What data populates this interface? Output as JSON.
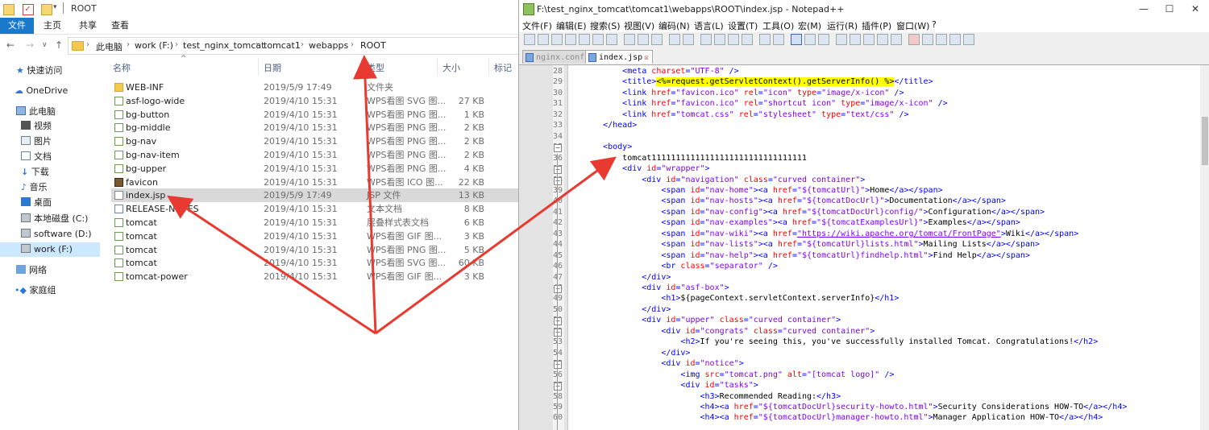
{
  "explorer": {
    "title": "ROOT",
    "ribbon_tabs": [
      "文件",
      "主页",
      "共享",
      "查看"
    ],
    "breadcrumb": [
      "此电脑",
      "work (F:)",
      "test_nginx_tomcat",
      "tomcat1",
      "webapps",
      "ROOT"
    ],
    "sidebar": [
      {
        "label": "快速访问",
        "icon": "star-icon"
      },
      {
        "label": "OneDrive",
        "icon": "cloud-icon"
      },
      {
        "label": "此电脑",
        "icon": "computer-icon"
      },
      {
        "label": "视频",
        "icon": "video-icon"
      },
      {
        "label": "图片",
        "icon": "picture-icon"
      },
      {
        "label": "文档",
        "icon": "document-icon"
      },
      {
        "label": "下载",
        "icon": "download-icon"
      },
      {
        "label": "音乐",
        "icon": "music-icon"
      },
      {
        "label": "桌面",
        "icon": "desktop-icon"
      },
      {
        "label": "本地磁盘 (C:)",
        "icon": "drive-icon"
      },
      {
        "label": "software (D:)",
        "icon": "drive-icon"
      },
      {
        "label": "work (F:)",
        "icon": "drive-icon",
        "selected": true
      },
      {
        "label": "网络",
        "icon": "network-icon"
      },
      {
        "label": "家庭组",
        "icon": "homegroup-icon"
      }
    ],
    "columns": {
      "name": "名称",
      "date": "日期",
      "type": "类型",
      "size": "大小",
      "tags": "标记"
    },
    "files": [
      {
        "name": "WEB-INF",
        "date": "2019/5/9 17:49",
        "type": "文件夹",
        "size": "",
        "icon": "folder-icon"
      },
      {
        "name": "asf-logo-wide",
        "date": "2019/4/10 15:31",
        "type": "WPS看图 SVG 图...",
        "size": "27 KB",
        "icon": "image-icon"
      },
      {
        "name": "bg-button",
        "date": "2019/4/10 15:31",
        "type": "WPS看图 PNG 图...",
        "size": "1 KB",
        "icon": "image-icon"
      },
      {
        "name": "bg-middle",
        "date": "2019/4/10 15:31",
        "type": "WPS看图 PNG 图...",
        "size": "2 KB",
        "icon": "image-icon"
      },
      {
        "name": "bg-nav",
        "date": "2019/4/10 15:31",
        "type": "WPS看图 PNG 图...",
        "size": "2 KB",
        "icon": "image-icon"
      },
      {
        "name": "bg-nav-item",
        "date": "2019/4/10 15:31",
        "type": "WPS看图 PNG 图...",
        "size": "2 KB",
        "icon": "image-icon"
      },
      {
        "name": "bg-upper",
        "date": "2019/4/10 15:31",
        "type": "WPS看图 PNG 图...",
        "size": "4 KB",
        "icon": "image-icon"
      },
      {
        "name": "favicon",
        "date": "2019/4/10 15:31",
        "type": "WPS看图 ICO 图...",
        "size": "22 KB",
        "icon": "favicon-icon"
      },
      {
        "name": "index.jsp",
        "date": "2019/5/9 17:49",
        "type": "JSP 文件",
        "size": "13 KB",
        "icon": "file-icon",
        "selected": true
      },
      {
        "name": "RELEASE-NOTES",
        "date": "2019/4/10 15:31",
        "type": "文本文档",
        "size": "8 KB",
        "icon": "text-file-icon"
      },
      {
        "name": "tomcat",
        "date": "2019/4/10 15:31",
        "type": "层叠样式表文档",
        "size": "6 KB",
        "icon": "css-file-icon"
      },
      {
        "name": "tomcat",
        "date": "2019/4/10 15:31",
        "type": "WPS看图 GIF 图...",
        "size": "3 KB",
        "icon": "image-icon"
      },
      {
        "name": "tomcat",
        "date": "2019/4/10 15:31",
        "type": "WPS看图 PNG 图...",
        "size": "5 KB",
        "icon": "image-icon"
      },
      {
        "name": "tomcat",
        "date": "2019/4/10 15:31",
        "type": "WPS看图 SVG 图...",
        "size": "60 KB",
        "icon": "image-icon"
      },
      {
        "name": "tomcat-power",
        "date": "2019/4/10 15:31",
        "type": "WPS看图 GIF 图...",
        "size": "3 KB",
        "icon": "image-icon"
      }
    ]
  },
  "npp": {
    "title": "F:\\test_nginx_tomcat\\tomcat1\\webapps\\ROOT\\index.jsp - Notepad++",
    "menu": [
      "文件(F)",
      "编辑(E)",
      "搜索(S)",
      "视图(V)",
      "编码(N)",
      "语言(L)",
      "设置(T)",
      "工具(O)",
      "宏(M)",
      "运行(R)",
      "插件(P)",
      "窗口(W)",
      "?"
    ],
    "tabs": [
      {
        "label": "nginx.conf",
        "active": false
      },
      {
        "label": "index.jsp",
        "active": true
      }
    ],
    "first_line": 28,
    "lines": [
      [
        [
          "i",
          "        "
        ],
        [
          "t",
          "<meta "
        ],
        [
          "a",
          "charset"
        ],
        [
          "t",
          "="
        ],
        [
          "v",
          "\"UTF-8\""
        ],
        [
          "t",
          " />"
        ]
      ],
      [
        [
          "i",
          "        "
        ],
        [
          "t",
          "<title>"
        ],
        [
          "h",
          "<%=request.getServletContext().getServerInfo() %>"
        ],
        [
          "t",
          "</title>"
        ]
      ],
      [
        [
          "i",
          "        "
        ],
        [
          "t",
          "<link "
        ],
        [
          "a",
          "href"
        ],
        [
          "t",
          "="
        ],
        [
          "v",
          "\"favicon.ico\""
        ],
        [
          "t",
          " "
        ],
        [
          "a",
          "rel"
        ],
        [
          "t",
          "="
        ],
        [
          "v",
          "\"icon\""
        ],
        [
          "t",
          " "
        ],
        [
          "a",
          "type"
        ],
        [
          "t",
          "="
        ],
        [
          "v",
          "\"image/x-icon\""
        ],
        [
          "t",
          " />"
        ]
      ],
      [
        [
          "i",
          "        "
        ],
        [
          "t",
          "<link "
        ],
        [
          "a",
          "href"
        ],
        [
          "t",
          "="
        ],
        [
          "v",
          "\"favicon.ico\""
        ],
        [
          "t",
          " "
        ],
        [
          "a",
          "rel"
        ],
        [
          "t",
          "="
        ],
        [
          "v",
          "\"shortcut icon\""
        ],
        [
          "t",
          " "
        ],
        [
          "a",
          "type"
        ],
        [
          "t",
          "="
        ],
        [
          "v",
          "\"image/x-icon\""
        ],
        [
          "t",
          " />"
        ]
      ],
      [
        [
          "i",
          "        "
        ],
        [
          "t",
          "<link "
        ],
        [
          "a",
          "href"
        ],
        [
          "t",
          "="
        ],
        [
          "v",
          "\"tomcat.css\""
        ],
        [
          "t",
          " "
        ],
        [
          "a",
          "rel"
        ],
        [
          "t",
          "="
        ],
        [
          "v",
          "\"stylesheet\""
        ],
        [
          "t",
          " "
        ],
        [
          "a",
          "type"
        ],
        [
          "t",
          "="
        ],
        [
          "v",
          "\"text/css\""
        ],
        [
          "t",
          " />"
        ]
      ],
      [
        [
          "i",
          "    "
        ],
        [
          "t",
          "</head>"
        ]
      ],
      [
        [
          "i",
          ""
        ]
      ],
      [
        [
          "i",
          "    "
        ],
        [
          "t",
          "<body>"
        ]
      ],
      [
        [
          "i",
          "        "
        ],
        [
          "x",
          "tomcat11111111111111111111111111111111"
        ]
      ],
      [
        [
          "i",
          "        "
        ],
        [
          "t",
          "<div "
        ],
        [
          "a",
          "id"
        ],
        [
          "t",
          "="
        ],
        [
          "v",
          "\"wrapper\""
        ],
        [
          "t",
          ">"
        ]
      ],
      [
        [
          "i",
          "            "
        ],
        [
          "t",
          "<div "
        ],
        [
          "a",
          "id"
        ],
        [
          "t",
          "="
        ],
        [
          "v",
          "\"navigation\""
        ],
        [
          "t",
          " "
        ],
        [
          "a",
          "class"
        ],
        [
          "t",
          "="
        ],
        [
          "v",
          "\"curved container\""
        ],
        [
          "t",
          ">"
        ]
      ],
      [
        [
          "i",
          "                "
        ],
        [
          "t",
          "<span "
        ],
        [
          "a",
          "id"
        ],
        [
          "t",
          "="
        ],
        [
          "v",
          "\"nav-home\""
        ],
        [
          "t",
          "><a "
        ],
        [
          "a",
          "href"
        ],
        [
          "t",
          "="
        ],
        [
          "v",
          "\"${tomcatUrl}\""
        ],
        [
          "t",
          ">"
        ],
        [
          "x",
          "Home"
        ],
        [
          "t",
          "</a></span>"
        ]
      ],
      [
        [
          "i",
          "                "
        ],
        [
          "t",
          "<span "
        ],
        [
          "a",
          "id"
        ],
        [
          "t",
          "="
        ],
        [
          "v",
          "\"nav-hosts\""
        ],
        [
          "t",
          "><a "
        ],
        [
          "a",
          "href"
        ],
        [
          "t",
          "="
        ],
        [
          "v",
          "\"${tomcatDocUrl}\""
        ],
        [
          "t",
          ">"
        ],
        [
          "x",
          "Documentation"
        ],
        [
          "t",
          "</a></span>"
        ]
      ],
      [
        [
          "i",
          "                "
        ],
        [
          "t",
          "<span "
        ],
        [
          "a",
          "id"
        ],
        [
          "t",
          "="
        ],
        [
          "v",
          "\"nav-config\""
        ],
        [
          "t",
          "><a "
        ],
        [
          "a",
          "href"
        ],
        [
          "t",
          "="
        ],
        [
          "v",
          "\"${tomcatDocUrl}config/\""
        ],
        [
          "t",
          ">"
        ],
        [
          "x",
          "Configuration"
        ],
        [
          "t",
          "</a></span>"
        ]
      ],
      [
        [
          "i",
          "                "
        ],
        [
          "t",
          "<span "
        ],
        [
          "a",
          "id"
        ],
        [
          "t",
          "="
        ],
        [
          "v",
          "\"nav-examples\""
        ],
        [
          "t",
          "><a "
        ],
        [
          "a",
          "href"
        ],
        [
          "t",
          "="
        ],
        [
          "v",
          "\"${tomcatExamplesUrl}\""
        ],
        [
          "t",
          ">"
        ],
        [
          "x",
          "Examples"
        ],
        [
          "t",
          "</a></span>"
        ]
      ],
      [
        [
          "i",
          "                "
        ],
        [
          "t",
          "<span "
        ],
        [
          "a",
          "id"
        ],
        [
          "t",
          "="
        ],
        [
          "v",
          "\"nav-wiki\""
        ],
        [
          "t",
          "><a "
        ],
        [
          "a",
          "href"
        ],
        [
          "t",
          "="
        ],
        [
          "u",
          "\"https://wiki.apache.org/tomcat/FrontPage\""
        ],
        [
          "t",
          ">"
        ],
        [
          "x",
          "Wiki"
        ],
        [
          "t",
          "</a></span>"
        ]
      ],
      [
        [
          "i",
          "                "
        ],
        [
          "t",
          "<span "
        ],
        [
          "a",
          "id"
        ],
        [
          "t",
          "="
        ],
        [
          "v",
          "\"nav-lists\""
        ],
        [
          "t",
          "><a "
        ],
        [
          "a",
          "href"
        ],
        [
          "t",
          "="
        ],
        [
          "v",
          "\"${tomcatUrl}lists.html\""
        ],
        [
          "t",
          ">"
        ],
        [
          "x",
          "Mailing Lists"
        ],
        [
          "t",
          "</a></span>"
        ]
      ],
      [
        [
          "i",
          "                "
        ],
        [
          "t",
          "<span "
        ],
        [
          "a",
          "id"
        ],
        [
          "t",
          "="
        ],
        [
          "v",
          "\"nav-help\""
        ],
        [
          "t",
          "><a "
        ],
        [
          "a",
          "href"
        ],
        [
          "t",
          "="
        ],
        [
          "v",
          "\"${tomcatUrl}findhelp.html\""
        ],
        [
          "t",
          ">"
        ],
        [
          "x",
          "Find Help"
        ],
        [
          "t",
          "</a></span>"
        ]
      ],
      [
        [
          "i",
          "                "
        ],
        [
          "t",
          "<br "
        ],
        [
          "a",
          "class"
        ],
        [
          "t",
          "="
        ],
        [
          "v",
          "\"separator\""
        ],
        [
          "t",
          " />"
        ]
      ],
      [
        [
          "i",
          "            "
        ],
        [
          "t",
          "</div>"
        ]
      ],
      [
        [
          "i",
          "            "
        ],
        [
          "t",
          "<div "
        ],
        [
          "a",
          "id"
        ],
        [
          "t",
          "="
        ],
        [
          "v",
          "\"asf-box\""
        ],
        [
          "t",
          ">"
        ]
      ],
      [
        [
          "i",
          "                "
        ],
        [
          "t",
          "<h1>"
        ],
        [
          "x",
          "${pageContext.servletContext.serverInfo}"
        ],
        [
          "t",
          "</h1>"
        ]
      ],
      [
        [
          "i",
          "            "
        ],
        [
          "t",
          "</div>"
        ]
      ],
      [
        [
          "i",
          "            "
        ],
        [
          "t",
          "<div "
        ],
        [
          "a",
          "id"
        ],
        [
          "t",
          "="
        ],
        [
          "v",
          "\"upper\""
        ],
        [
          "t",
          " "
        ],
        [
          "a",
          "class"
        ],
        [
          "t",
          "="
        ],
        [
          "v",
          "\"curved container\""
        ],
        [
          "t",
          ">"
        ]
      ],
      [
        [
          "i",
          "                "
        ],
        [
          "t",
          "<div "
        ],
        [
          "a",
          "id"
        ],
        [
          "t",
          "="
        ],
        [
          "v",
          "\"congrats\""
        ],
        [
          "t",
          " "
        ],
        [
          "a",
          "class"
        ],
        [
          "t",
          "="
        ],
        [
          "v",
          "\"curved container\""
        ],
        [
          "t",
          ">"
        ]
      ],
      [
        [
          "i",
          "                    "
        ],
        [
          "t",
          "<h2>"
        ],
        [
          "x",
          "If you're seeing this, you've successfully installed Tomcat. Congratulations!"
        ],
        [
          "t",
          "</h2>"
        ]
      ],
      [
        [
          "i",
          "                "
        ],
        [
          "t",
          "</div>"
        ]
      ],
      [
        [
          "i",
          "                "
        ],
        [
          "t",
          "<div "
        ],
        [
          "a",
          "id"
        ],
        [
          "t",
          "="
        ],
        [
          "v",
          "\"notice\""
        ],
        [
          "t",
          ">"
        ]
      ],
      [
        [
          "i",
          "                    "
        ],
        [
          "t",
          "<img "
        ],
        [
          "a",
          "src"
        ],
        [
          "t",
          "="
        ],
        [
          "v",
          "\"tomcat.png\""
        ],
        [
          "t",
          " "
        ],
        [
          "a",
          "alt"
        ],
        [
          "t",
          "="
        ],
        [
          "v",
          "\"[tomcat logo]\""
        ],
        [
          "t",
          " />"
        ]
      ],
      [
        [
          "i",
          "                    "
        ],
        [
          "t",
          "<div "
        ],
        [
          "a",
          "id"
        ],
        [
          "t",
          "="
        ],
        [
          "v",
          "\"tasks\""
        ],
        [
          "t",
          ">"
        ]
      ],
      [
        [
          "i",
          "                        "
        ],
        [
          "t",
          "<h3>"
        ],
        [
          "x",
          "Recommended Reading:"
        ],
        [
          "t",
          "</h3>"
        ]
      ],
      [
        [
          "i",
          "                        "
        ],
        [
          "t",
          "<h4><a "
        ],
        [
          "a",
          "href"
        ],
        [
          "t",
          "="
        ],
        [
          "v",
          "\"${tomcatDocUrl}security-howto.html\""
        ],
        [
          "t",
          ">"
        ],
        [
          "x",
          "Security Considerations HOW-TO"
        ],
        [
          "t",
          "</a></h4>"
        ]
      ],
      [
        [
          "i",
          "                        "
        ],
        [
          "t",
          "<h4><a "
        ],
        [
          "a",
          "href"
        ],
        [
          "t",
          "="
        ],
        [
          "v",
          "\"${tomcatDocUrl}manager-howto.html\""
        ],
        [
          "t",
          ">"
        ],
        [
          "x",
          "Manager Application HOW-TO"
        ],
        [
          "t",
          "</a></h4>"
        ]
      ]
    ]
  },
  "colors": {
    "tag": "#0000ff",
    "attribute": "#ff0000",
    "value": "#8000ff",
    "highlight": "#ffff00",
    "arrow": "#e83a30",
    "ribbon_active": "#1979ca"
  }
}
